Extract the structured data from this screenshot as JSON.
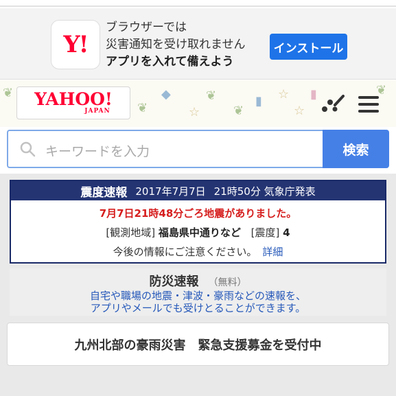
{
  "app_banner": {
    "icon_text": "Y!",
    "line1": "ブラウザーでは",
    "line2": "災害通知を受け取れません",
    "line3": "アプリを入れて備えよう",
    "install_label": "インストール"
  },
  "header": {
    "logo_main": "YAHOO!",
    "logo_sub": "JAPAN"
  },
  "search": {
    "placeholder": "キーワードを入力",
    "button_label": "検索"
  },
  "earthquake": {
    "title": "震度速報",
    "date": "2017年7月7日",
    "time_agency": "21時50分 気象庁発表",
    "headline": "7月7日21時48分ごろ地震がありました。",
    "area_label": "[観測地域]",
    "area_value": "福島県中通りなど",
    "intensity_label": "[震度]",
    "intensity_value": "4",
    "notice": "今後の情報にご注意ください。",
    "detail_link": "詳細"
  },
  "disaster_alert": {
    "title": "防災速報",
    "free_tag": "（無料）",
    "text_line1": "自宅や職場の地震・津波・豪雨などの速報を、",
    "text_line2": "アプリやメールでも受けとることができます。"
  },
  "relief_banner": {
    "label": "九州北部の豪雨災害　緊急支援募金を受付中"
  },
  "colors": {
    "brand_red": "#ff0033",
    "install_blue": "#1e73e8",
    "search_blue": "#4580e6",
    "quake_navy": "#243473",
    "alert_red": "#d61e1e",
    "link_blue": "#2558b9"
  }
}
